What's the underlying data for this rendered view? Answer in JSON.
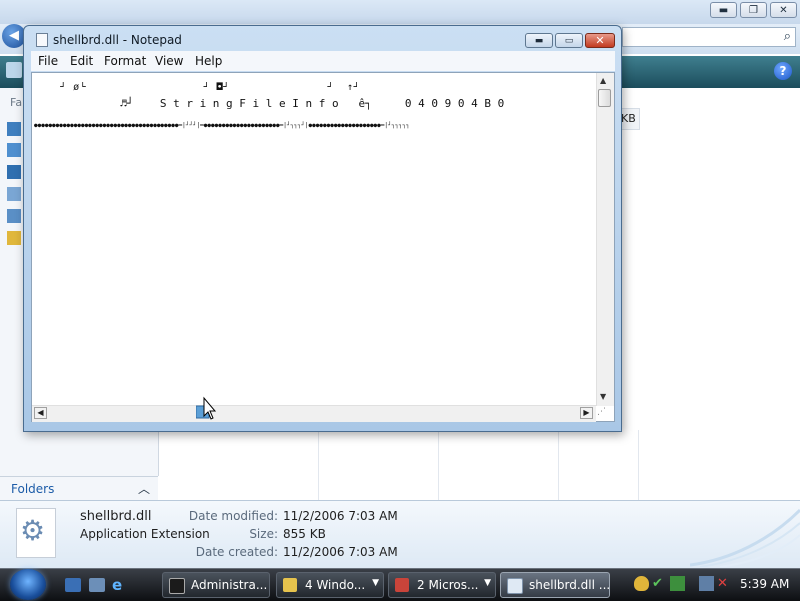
{
  "explorer": {
    "window_controls": {
      "minimize": "▬",
      "maximize": "❐",
      "close": "✕"
    },
    "nav_pane": {
      "favorites_label": "Fa"
    },
    "column_header_fragment": "KB",
    "folders_label": "Folders",
    "details": {
      "file_name": "shellbrd.dll",
      "file_type": "Application Extension",
      "date_modified_label": "Date modified:",
      "date_modified_value": "11/2/2006 7:03 AM",
      "size_label": "Size:",
      "size_value": "855 KB",
      "date_created_label": "Date created:",
      "date_created_value": "11/2/2006 7:03 AM"
    }
  },
  "notepad": {
    "title": "shellbrd.dll - Notepad",
    "controls": {
      "minimize": "▬",
      "maximize": "▭",
      "close": "✕"
    },
    "menu": [
      "File",
      "Edit",
      "Format",
      "View",
      "Help"
    ],
    "content_lines": [
      "    ┘ ø└                  ┘ ◘┘               ┘  ↑┘",
      "             ♬┘    S t r i n g F i l e I n f o   ê┐     0 4 0 9 0 4 B 0",
      "●●●●●●●●●●●●●●●●●●●●●●●●●●●●●●●●●●●●●●●●━|┘┘┘|━●●●●●●●●●●●●●●●●●●●●●━|┘┐┐┐┘|●●●●●●●●●●●●●●●●●●●●━|┘┐┐┐┐┐"
    ]
  },
  "taskbar": {
    "buttons": [
      {
        "label": "Administra...",
        "has_menu": false,
        "active": false
      },
      {
        "label": "4 Windo...",
        "has_menu": true,
        "active": false
      },
      {
        "label": "2 Micros...",
        "has_menu": true,
        "active": false
      },
      {
        "label": "shellbrd.dll ...",
        "has_menu": false,
        "active": true
      }
    ],
    "clock": "5:39 AM"
  },
  "icons": {
    "back": "back-arrow-icon",
    "search": "search-icon",
    "help": "help-icon",
    "start": "windows-start-orb-icon"
  },
  "colors": {
    "taskbar_bg": "#1a1d22",
    "toolbar_teal": "#2a6272",
    "notepad_frame": "#bcd3ec",
    "folders_link": "#1c5ca8"
  }
}
